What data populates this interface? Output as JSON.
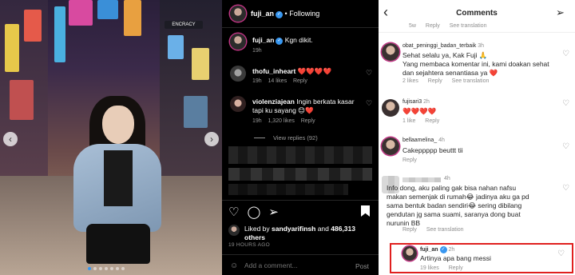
{
  "colors": {
    "accent": "#3897f0",
    "like_red": "#ed4956",
    "highlight_border": "#e0201f",
    "dark_bg": "#000000"
  },
  "photo": {
    "sign_text": "ENCRACY"
  },
  "dark_panel": {
    "header": {
      "username": "fuji_an",
      "separator": "•",
      "following": "Following"
    },
    "caption": {
      "username": "fuji_an",
      "text": "Kgn dikit.",
      "time": "19h"
    },
    "comments": [
      {
        "username": "thofu_inheart",
        "text": "❤️❤️❤️❤️",
        "time": "19h",
        "likes": "14 likes",
        "reply": "Reply"
      },
      {
        "username": "violenziajean",
        "text": "Ingin berkata kasar tapi ku sayang 😊❤️",
        "time": "19h",
        "likes": "1,320 likes",
        "reply": "Reply"
      }
    ],
    "view_replies": "View replies (92)",
    "liked_by": {
      "prefix": "Liked by",
      "user": "sandyarifinsh",
      "middle": "and",
      "count": "486,313",
      "suffix": "others"
    },
    "time_ago": "19 HOURS AGO",
    "add_comment": {
      "placeholder": "Add a comment...",
      "post": "Post"
    }
  },
  "light_panel": {
    "title": "Comments",
    "top_meta": {
      "time": "5w",
      "likes": "",
      "reply": "Reply",
      "translate": "See translation"
    },
    "comments": [
      {
        "username": "obat_peninggi_badan_terbaik",
        "time": "3h",
        "lines": [
          "Sehat selalu ya, Kak Fuji 🙏",
          "Yang membaca komentar ini, kami doakan sehat",
          "dan sejahtera senantiasa ya ❤️"
        ],
        "likes": "2 likes",
        "reply": "Reply",
        "translate": "See translation"
      },
      {
        "username": "fujisari3",
        "time": "2h",
        "lines": [
          "❤️❤️❤️❤️"
        ],
        "likes": "1 like",
        "reply": "Reply"
      },
      {
        "username": "bellaamelina_",
        "time": "4h",
        "lines": [
          "Cakeppppp beuttt tii"
        ],
        "likes": "",
        "reply": "Reply"
      },
      {
        "username": "",
        "time": "4h",
        "lines": [
          "Info dong, aku paling gak bisa nahan nafsu",
          "makan semenjak di rumah😂 jadinya aku ga pd",
          "sama bentuk badan sendiri😂 sering dibilang",
          "gendutan jg sama suami, saranya dong buat",
          "nurunin BB"
        ],
        "likes": "",
        "reply": "Reply",
        "translate": "See translation"
      },
      {
        "username": "fuji_an",
        "time": "2h",
        "lines": [
          "Artinya apa bang messi"
        ],
        "likes": "19 likes",
        "reply": "Reply"
      }
    ]
  }
}
